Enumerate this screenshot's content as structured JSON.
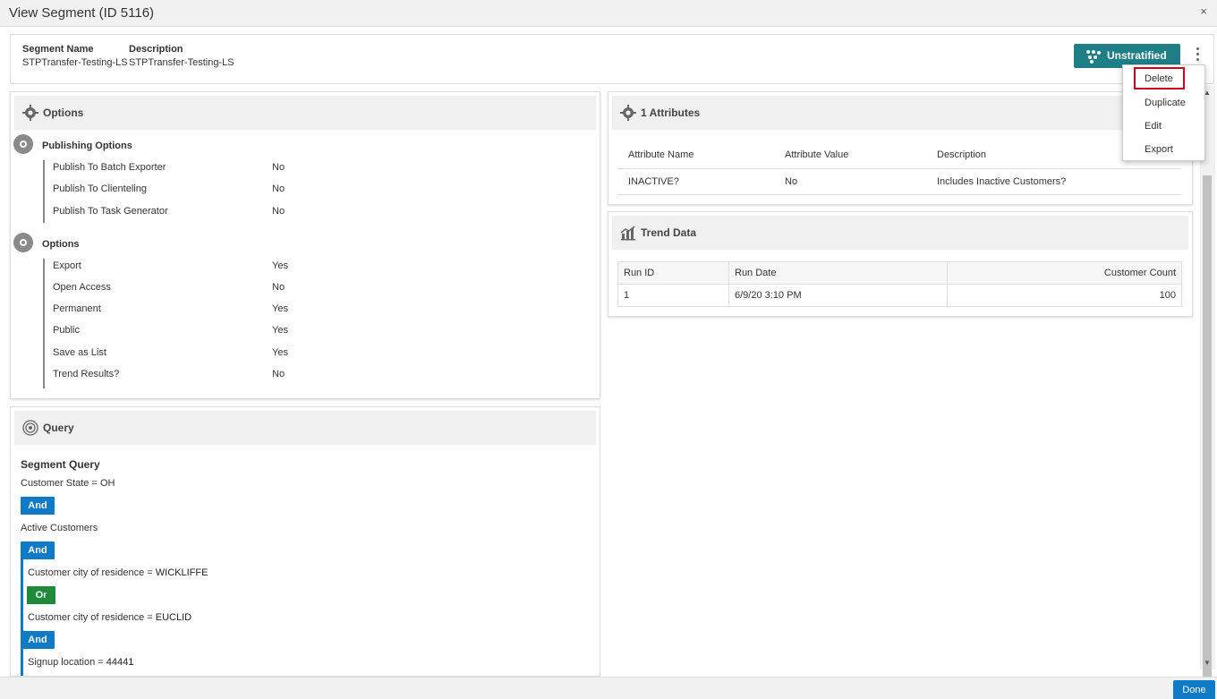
{
  "window": {
    "title": "View Segment (ID 5116)",
    "close": "×"
  },
  "header": {
    "segment_name_label": "Segment Name",
    "segment_name_value": "STPTransfer-Testing-LS",
    "description_label": "Description",
    "description_value": "STPTransfer-Testing-LS",
    "stratify_button": "Unstratified"
  },
  "menu": {
    "items": [
      "Delete",
      "Duplicate",
      "Edit",
      "Export"
    ],
    "highlighted": "Delete"
  },
  "options_panel": {
    "title": "Options",
    "groups": [
      {
        "title": "Publishing Options",
        "rows": [
          {
            "name": "Publish To Batch Exporter",
            "value": "No"
          },
          {
            "name": "Publish To Clienteling",
            "value": "No"
          },
          {
            "name": "Publish To Task Generator",
            "value": "No"
          }
        ]
      },
      {
        "title": "Options",
        "rows": [
          {
            "name": "Export",
            "value": "Yes"
          },
          {
            "name": "Open Access",
            "value": "No"
          },
          {
            "name": "Permanent",
            "value": "Yes"
          },
          {
            "name": "Public",
            "value": "Yes"
          },
          {
            "name": "Save as List",
            "value": "Yes"
          },
          {
            "name": "Trend Results?",
            "value": "No"
          }
        ]
      }
    ]
  },
  "attributes_panel": {
    "title": "1 Attributes",
    "columns": [
      "Attribute Name",
      "Attribute Value",
      "Description"
    ],
    "rows": [
      [
        "INACTIVE?",
        "No",
        "Includes Inactive Customers?"
      ]
    ]
  },
  "trend_panel": {
    "title": "Trend Data",
    "columns": [
      "Run ID",
      "Run Date",
      "Customer Count"
    ],
    "rows": [
      [
        "1",
        "6/9/20 3:10 PM",
        "100"
      ]
    ]
  },
  "query_panel": {
    "title": "Query",
    "heading": "Segment Query",
    "line1": "Customer State = OH",
    "op1": "And",
    "line2": "Active Customers",
    "op2": "And",
    "line3_label": "Customer city of residence = ",
    "line3_value": "WICKLIFFE",
    "op3": "Or",
    "line4_label": "Customer city of residence = ",
    "line4_value": "EUCLID",
    "op4": "And",
    "line5_label": "Signup location = ",
    "line5_value": "44441"
  },
  "footer": {
    "done": "Done"
  },
  "colors": {
    "teal": "#1e7f86",
    "and_blue": "#0f7ac6",
    "or_green": "#1f8a3a",
    "highlight_red": "#d0021b"
  }
}
